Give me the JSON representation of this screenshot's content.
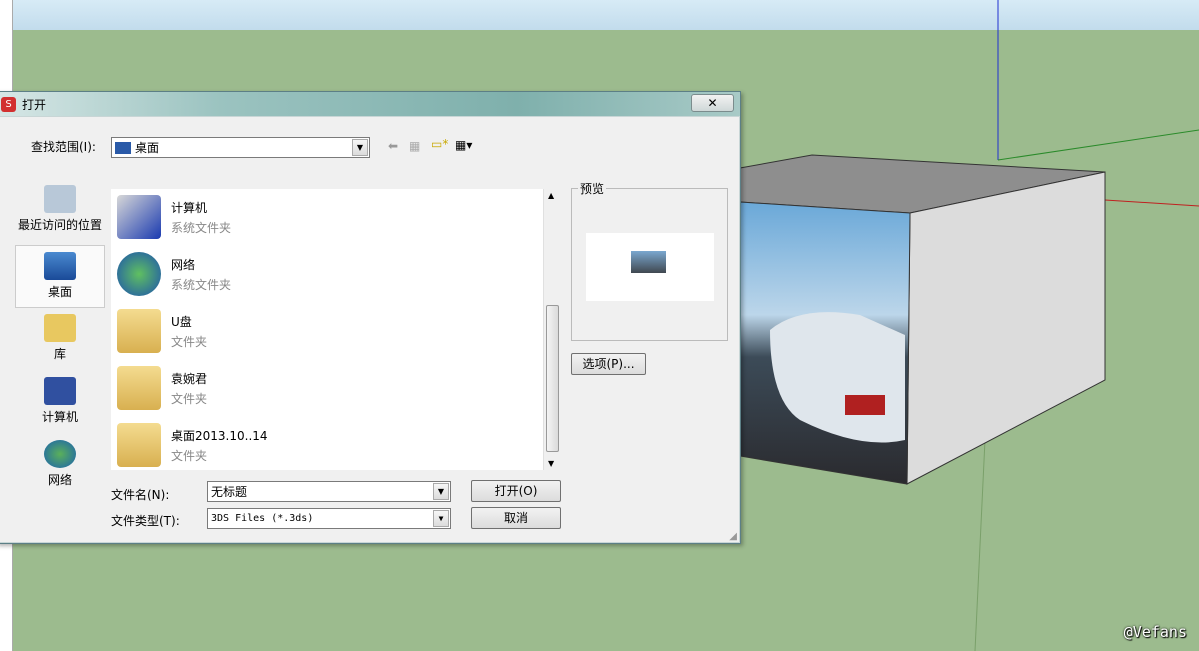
{
  "dialog": {
    "title": "打开",
    "close_label": "✕",
    "look_in_label": "查找范围(I):",
    "look_in_value": "桌面",
    "toolbar": {
      "back": "back-arrow-icon",
      "up": "up-folder-icon",
      "new_folder": "new-folder-icon",
      "views": "view-menu-icon"
    },
    "places": [
      {
        "label": "最近访问的位置",
        "icon": "recent-places-icon"
      },
      {
        "label": "桌面",
        "icon": "desktop-icon",
        "selected": true
      },
      {
        "label": "库",
        "icon": "library-icon"
      },
      {
        "label": "计算机",
        "icon": "computer-icon"
      },
      {
        "label": "网络",
        "icon": "network-icon"
      }
    ],
    "files": [
      {
        "name": "计算机",
        "type": "系统文件夹"
      },
      {
        "name": "网络",
        "type": "系统文件夹"
      },
      {
        "name": "U盘",
        "type": "文件夹"
      },
      {
        "name": "袁婉君",
        "type": "文件夹"
      },
      {
        "name": "桌面2013.10..14",
        "type": "文件夹"
      }
    ],
    "preview_label": "预览",
    "options_button": "选项(P)...",
    "filename_label": "文件名(N):",
    "filename_value": "无标题",
    "filetype_label": "文件类型(T):",
    "filetype_value": "3DS Files (*.3ds)",
    "open_button": "打开(O)",
    "cancel_button": "取消"
  },
  "watermark": "@Vefans",
  "colors": {
    "ground": "#9cbb8e",
    "titlebar": "#7fb0ac",
    "annotation": "#e00000"
  }
}
